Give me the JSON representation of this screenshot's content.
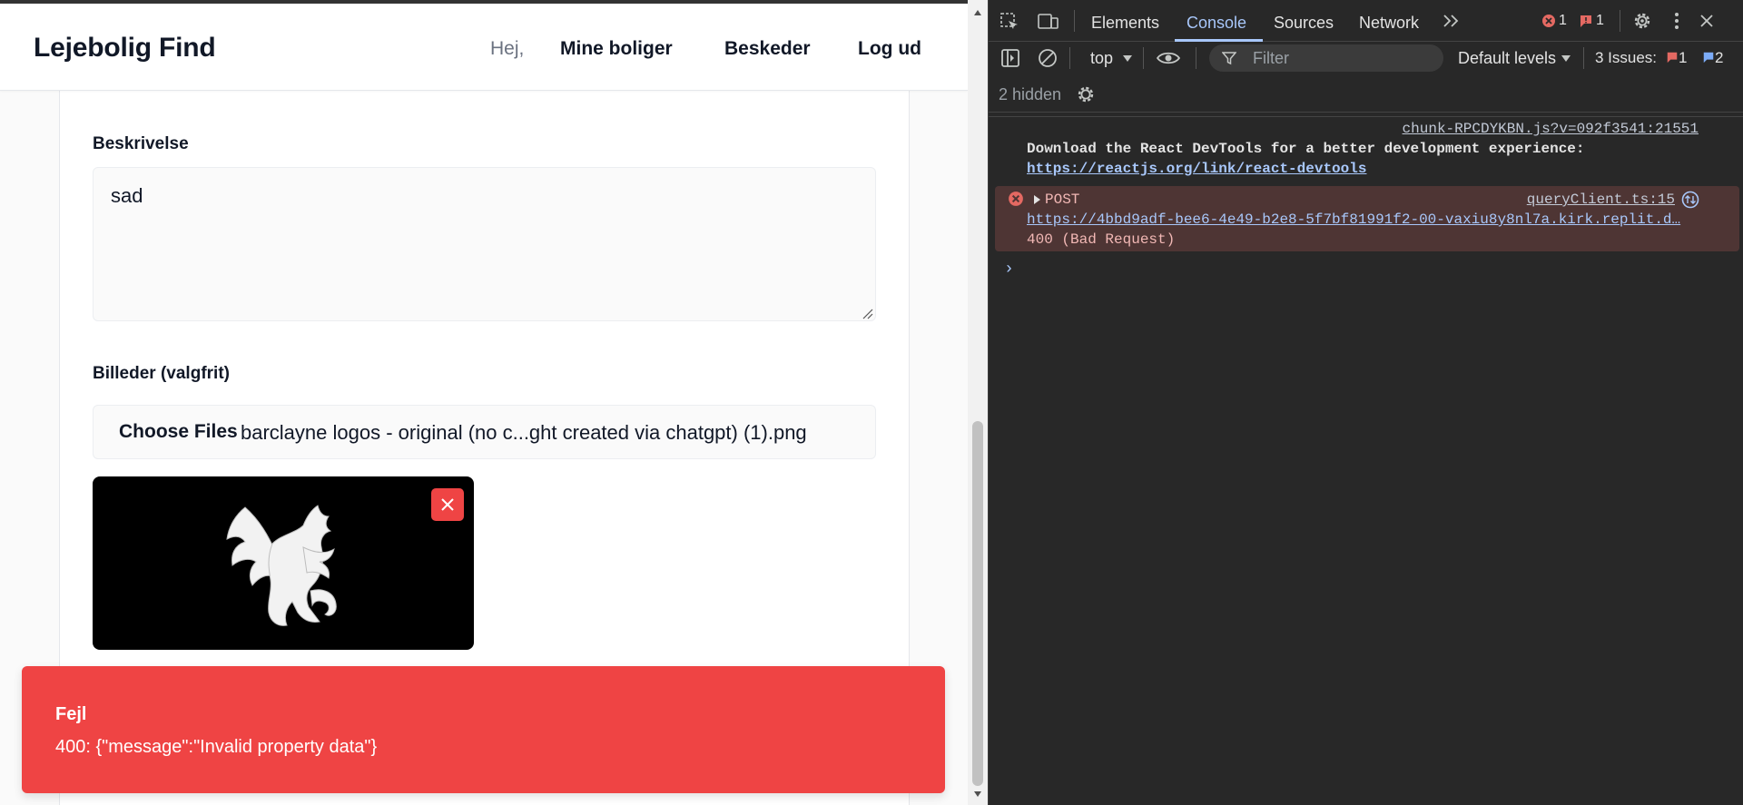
{
  "app": {
    "brand": "Lejebolig Find",
    "greeting": "Hej,",
    "nav": {
      "my_properties": "Mine boliger",
      "messages": "Beskeder",
      "logout": "Log ud"
    },
    "form": {
      "description_label": "Beskrivelse",
      "description_value": "sad",
      "images_label": "Billeder (valgfrit)",
      "choose_files_label": "Choose Files",
      "file_name": "barclayne logos - original (no c...ght created via chatgpt) (1).png"
    },
    "toast": {
      "title": "Fejl",
      "message": "400: {\"message\":\"Invalid property data\"}"
    }
  },
  "devtools": {
    "tabs": [
      "Elements",
      "Console",
      "Sources",
      "Network"
    ],
    "active_tab": "Console",
    "error_count": "1",
    "warning_count": "1",
    "context": "top",
    "filter_placeholder": "Filter",
    "levels": "Default levels",
    "issues_label": "3 Issues:",
    "issues_errors": "1",
    "issues_info": "2",
    "hidden": "2 hidden",
    "log": {
      "source": "chunk-RPCDYKBN.js?v=092f3541:21551",
      "message": "Download the React DevTools for a better development experience:",
      "link": "https://reactjs.org/link/react-devtools"
    },
    "error": {
      "method": "POST",
      "source": "queryClient.ts:15",
      "url": "https://4bbd9adf-bee6-4e49-b2e8-5f7bf81991f2-00-vaxiu8y8nl7a.kirk.replit.d…",
      "status": "400 (Bad Request)"
    },
    "prompt": "›"
  },
  "colors": {
    "toast_bg": "#ef4444",
    "devtools_bg": "#282828",
    "error_row_bg": "#4e3534",
    "link_blue": "#a8c7fa"
  }
}
